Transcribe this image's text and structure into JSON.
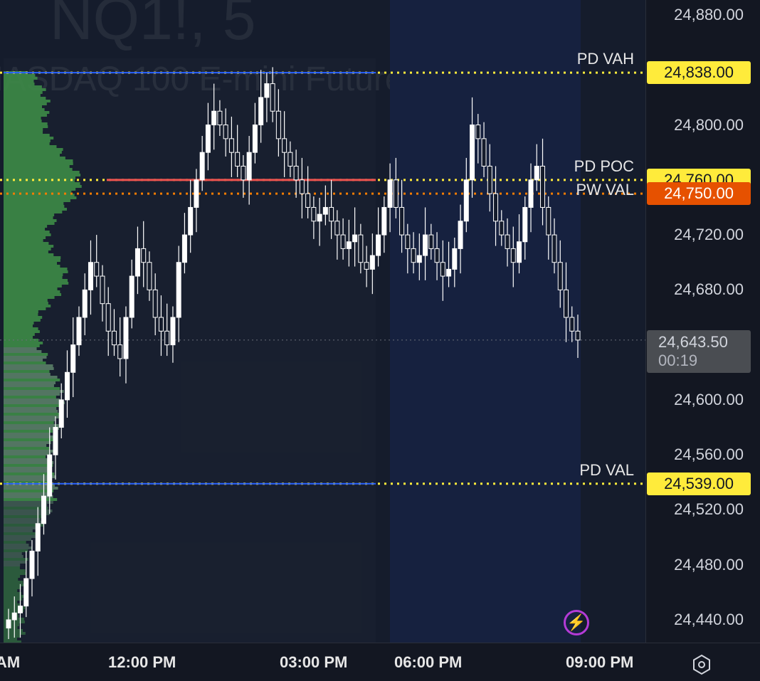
{
  "header": {
    "symbol": "NQ1!, 5",
    "description": "NASDAQ 100 E-mini Futures"
  },
  "chart_data": {
    "type": "candlestick",
    "timeframe": "5",
    "y_ticks": [
      "24,880.00",
      "24,800.00",
      "24,720.00",
      "24,680.00",
      "24,600.00",
      "24,560.00",
      "24,520.00",
      "24,480.00",
      "24,440.00"
    ],
    "y_tick_values": [
      24880,
      24800,
      24720,
      24680,
      24600,
      24560,
      24520,
      24480,
      24440
    ],
    "ylim": [
      24417,
      24887
    ],
    "x_ticks": [
      "AM",
      "12:00 PM",
      "03:00 PM",
      "06:00 PM",
      "09:00 PM"
    ],
    "levels": [
      {
        "name": "PD VAH",
        "value": 24838,
        "label": "24,838.00",
        "color": "#ffeb3b",
        "line_color": "#ffeb3b",
        "style": "dotted"
      },
      {
        "name": "PD POC",
        "value": 24760,
        "label": "24,760.00",
        "color": "#ffeb3b",
        "line_color": "#ffeb3b",
        "style": "dotted"
      },
      {
        "name": "PW VAL",
        "value": 24750,
        "label": "24,750.00",
        "color": "#e65100",
        "line_color": "#f57c00",
        "style": "dotted"
      },
      {
        "name": "PD VAL",
        "value": 24539,
        "label": "24,539.00",
        "color": "#ffeb3b",
        "line_color": "#ffeb3b",
        "style": "dotted"
      }
    ],
    "current": {
      "value": 24643.5,
      "label": "24,643.50",
      "countdown": "00:19"
    },
    "candles_approx_close": [
      24440,
      24445,
      24450,
      24470,
      24490,
      24510,
      24530,
      24560,
      24580,
      24600,
      24620,
      24640,
      24660,
      24680,
      24700,
      24690,
      24670,
      24650,
      24640,
      24630,
      24660,
      24690,
      24710,
      24700,
      24680,
      24660,
      24650,
      24640,
      24660,
      24700,
      24720,
      24740,
      24760,
      24780,
      24800,
      24810,
      24800,
      24790,
      24780,
      24770,
      24760,
      24780,
      24800,
      24820,
      24830,
      24810,
      24790,
      24780,
      24770,
      24760,
      24750,
      24740,
      24730,
      24735,
      24740,
      24730,
      24720,
      24710,
      24715,
      24720,
      24700,
      24695,
      24705,
      24720,
      24740,
      24760,
      24740,
      24720,
      24710,
      24700,
      24705,
      24720,
      24710,
      24700,
      24690,
      24695,
      24710,
      24730,
      24760,
      24800,
      24790,
      24770,
      24750,
      24730,
      24720,
      24710,
      24700,
      24715,
      24740,
      24760,
      24770,
      24740,
      24720,
      24700,
      24680,
      24660,
      24650,
      24643.5
    ],
    "volume_profile_max_bin_value": 24760
  },
  "colors": {
    "bg": "#151c2c",
    "session_bg": "#16213f",
    "candle": "#ffffff",
    "profile": "#3d8b47",
    "profile_light": "#8fcf98"
  },
  "icons": {
    "bolt": "lightning-icon",
    "settings": "hexagon-settings-icon"
  }
}
